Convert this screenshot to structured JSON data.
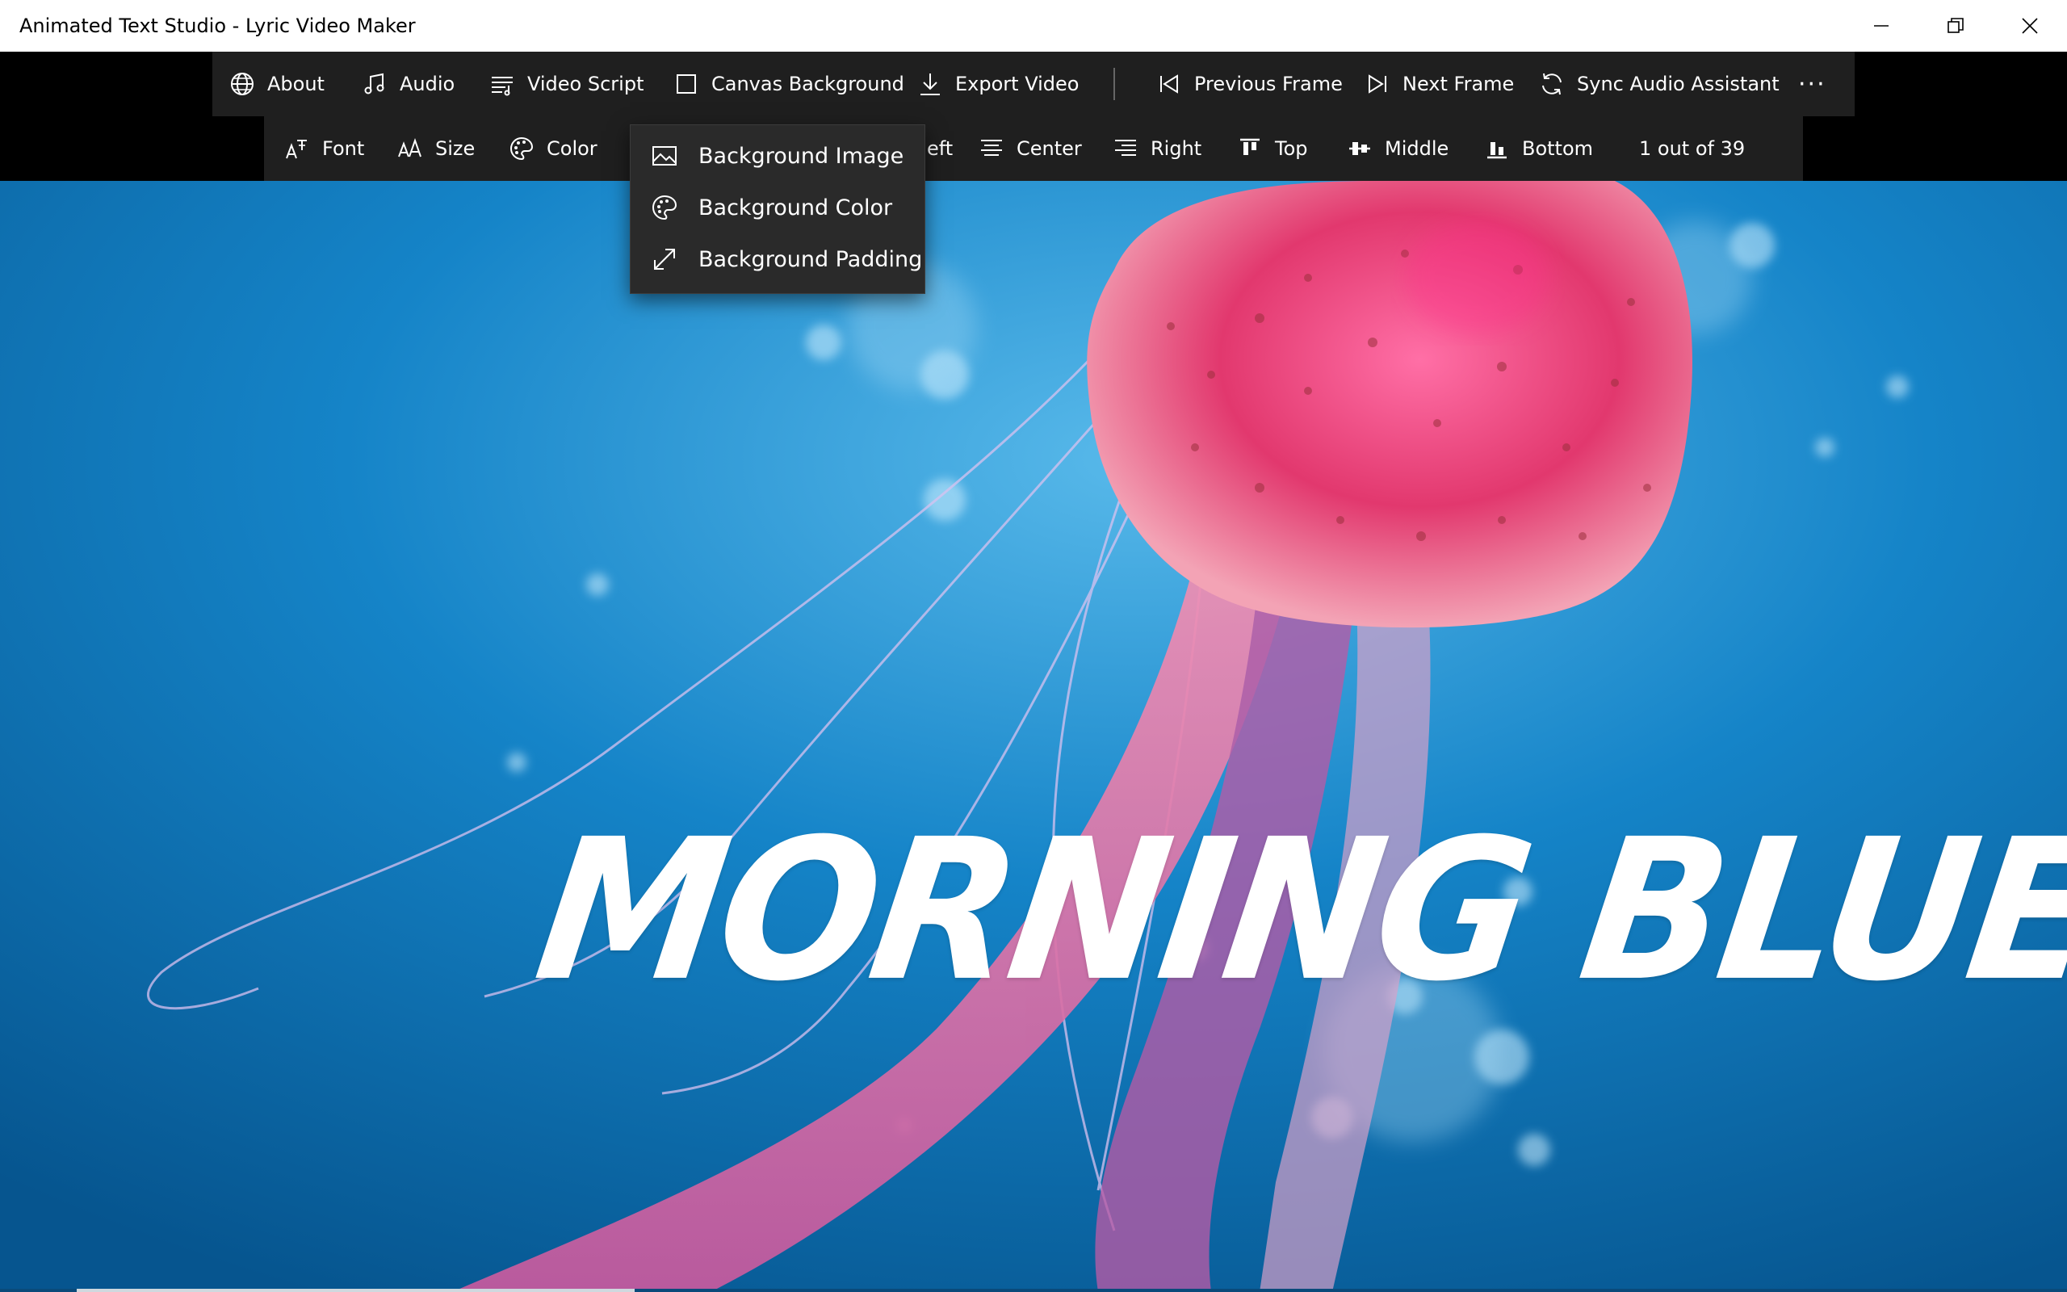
{
  "window": {
    "title": "Animated Text Studio - Lyric Video Maker",
    "controls": [
      "minimize-icon",
      "restore-icon",
      "close-icon"
    ]
  },
  "toolbar": {
    "about": "About",
    "audio": "Audio",
    "video_script": "Video Script",
    "canvas_background": "Canvas Background",
    "export_video": "Export Video",
    "previous_frame": "Previous Frame",
    "next_frame": "Next Frame",
    "sync_audio_assistant": "Sync Audio Assistant",
    "more": "···"
  },
  "text_toolbar": {
    "font": "Font",
    "size": "Size",
    "color": "Color",
    "left_partial": "eft",
    "center": "Center",
    "right": "Right",
    "top": "Top",
    "middle": "Middle",
    "bottom": "Bottom",
    "frame_counter": "1 out of 39"
  },
  "canvas_background_menu": {
    "items": [
      {
        "label": "Background Image",
        "icon": "image-icon"
      },
      {
        "label": "Background Color",
        "icon": "palette-icon"
      },
      {
        "label": "Background Padding",
        "icon": "expand-diagonal-icon"
      }
    ]
  },
  "canvas": {
    "lyric_text": "MORNING BLUE",
    "background_subject": "jellyfish underwater photo",
    "playback_progress": 0.27
  },
  "colors": {
    "title_bar": "#ffffff",
    "toolbar": "#1f1f1f",
    "strip": "#000000",
    "flyout": "#2a2a2a",
    "text": "#ffffff",
    "water": "#0a6fb3"
  }
}
